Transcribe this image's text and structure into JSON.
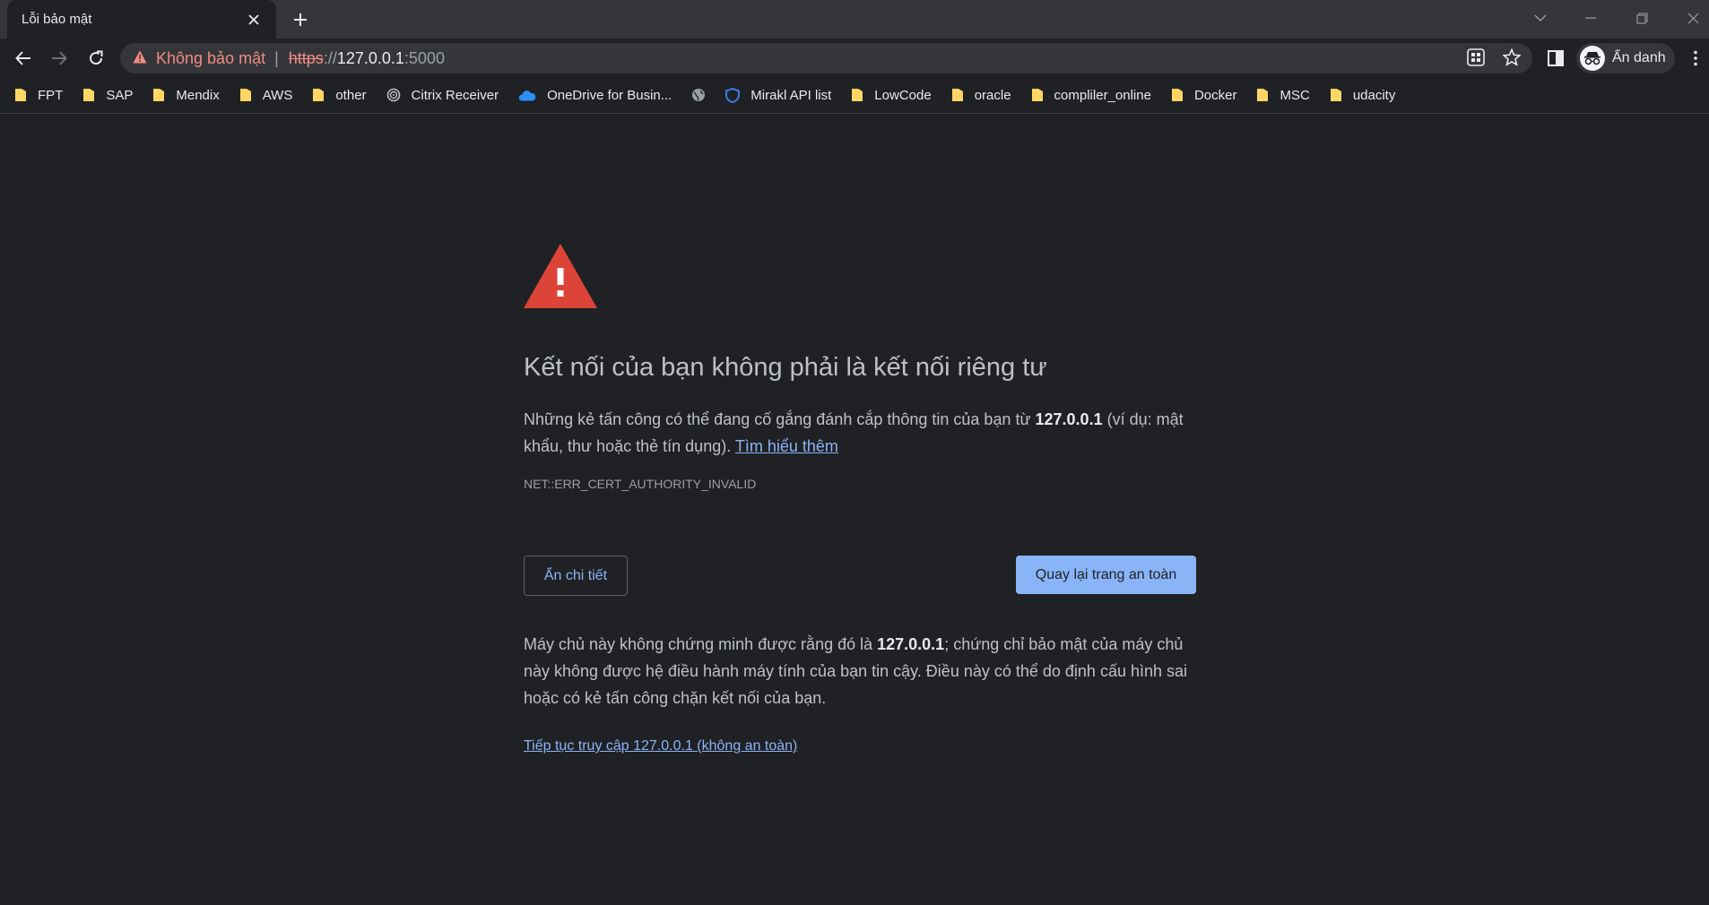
{
  "tab": {
    "title": "Lỗi bảo mật"
  },
  "omnibox": {
    "security_text": "Không bảo mật",
    "separator": "|",
    "scheme": "https",
    "slashes": "://",
    "host": "127.0.0.1",
    "port": ":5000"
  },
  "profile": {
    "label": "Ẩn danh"
  },
  "bookmarks": [
    {
      "label": "FPT",
      "icon": "folder-icon"
    },
    {
      "label": "SAP",
      "icon": "folder-icon"
    },
    {
      "label": "Mendix",
      "icon": "folder-icon"
    },
    {
      "label": "AWS",
      "icon": "folder-icon"
    },
    {
      "label": "other",
      "icon": "folder-icon"
    },
    {
      "label": "Citrix Receiver",
      "icon": "citrix-icon"
    },
    {
      "label": "OneDrive for Busin...",
      "icon": "onedrive-icon"
    },
    {
      "label": "",
      "icon": "globe-icon"
    },
    {
      "label": "Mirakl API list",
      "icon": "mirakl-shield-icon"
    },
    {
      "label": "LowCode",
      "icon": "folder-icon"
    },
    {
      "label": "oracle",
      "icon": "folder-icon"
    },
    {
      "label": "compliler_online",
      "icon": "folder-icon"
    },
    {
      "label": "Docker",
      "icon": "folder-icon"
    },
    {
      "label": "MSC",
      "icon": "folder-icon"
    },
    {
      "label": "udacity",
      "icon": "folder-icon"
    }
  ],
  "interstitial": {
    "heading": "Kết nối của bạn không phải là kết nối riêng tư",
    "explain_before": "Những kẻ tấn công có thể đang cố gắng đánh cắp thông tin của bạn từ ",
    "explain_host": "127.0.0.1",
    "explain_after": " (ví dụ: mật khẩu, thư hoặc thẻ tín dụng). ",
    "learn_more": "Tìm hiểu thêm",
    "error_code": "NET::ERR_CERT_AUTHORITY_INVALID",
    "hide_details_button": "Ẩn chi tiết",
    "back_to_safety_button": "Quay lại trang an toàn",
    "details_before": "Máy chủ này không chứng minh được rằng đó là ",
    "details_host": "127.0.0.1",
    "details_after": "; chứng chỉ bảo mật của máy chủ này không được hệ điều hành máy tính của bạn tin cậy. Điều này có thể do định cấu hình sai hoặc có kẻ tấn công chặn kết nối của bạn.",
    "proceed_link": "Tiếp tục truy cập 127.0.0.1 (không an toàn)"
  },
  "colors": {
    "background": "#202124",
    "warning_red": "#db4437",
    "link_blue": "#8ab4f8",
    "insecure_red": "#f28b82"
  }
}
